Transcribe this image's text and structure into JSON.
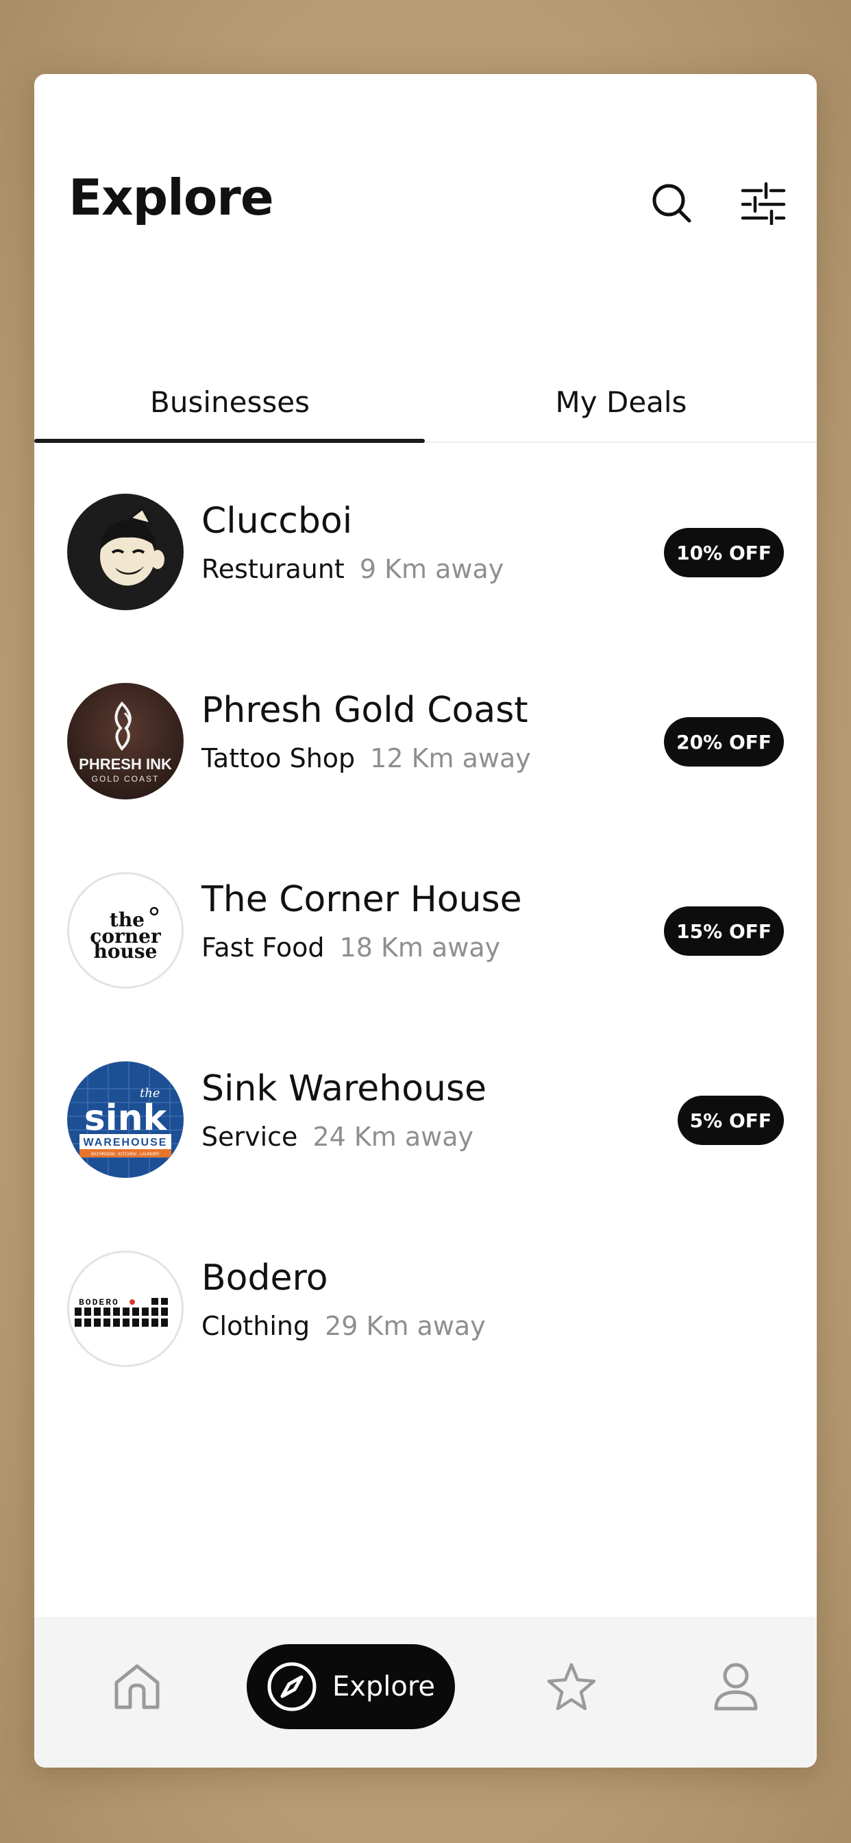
{
  "header": {
    "title": "Explore",
    "search_icon": "search-icon",
    "filter_icon": "sliders-icon"
  },
  "tabs": [
    {
      "label": "Businesses",
      "active": true
    },
    {
      "label": "My Deals",
      "active": false
    }
  ],
  "businesses": [
    {
      "name": "Cluccboi",
      "category": "Resturaunt",
      "distance": "9 Km away",
      "deal": "10% OFF",
      "logo": "cartoon-face-logo"
    },
    {
      "name": "Phresh Gold Coast",
      "category": "Tattoo Shop",
      "distance": "12 Km away",
      "deal": "20% OFF",
      "logo": "phresh-ink-logo",
      "logo_text": "PHRESH INK",
      "logo_subtext": "GOLD COAST"
    },
    {
      "name": "The Corner House",
      "category": "Fast Food",
      "distance": "18 Km away",
      "deal": "15% OFF",
      "logo": "corner-house-logo",
      "logo_text": [
        "the",
        "corner",
        "house"
      ]
    },
    {
      "name": "Sink Warehouse",
      "category": "Service",
      "distance": "24 Km away",
      "deal": "5% OFF",
      "logo": "sink-warehouse-logo",
      "logo_text": [
        "the",
        "sink",
        "WAREHOUSE",
        "BATHROOM · KITCHEN · LAUNDRY"
      ]
    },
    {
      "name": "Bodero",
      "category": "Clothing",
      "distance": "29 Km away",
      "deal": null,
      "logo": "bodero-logo",
      "logo_text": "BODERO"
    }
  ],
  "bottom_nav": {
    "home_icon": "home-icon",
    "explore_label": "Explore",
    "explore_icon": "compass-icon",
    "favorites_icon": "star-icon",
    "profile_icon": "user-icon",
    "active": "explore"
  },
  "colors": {
    "background": "#b89f78",
    "card": "#ffffff",
    "text": "#111111",
    "muted": "#8f8f8f",
    "badge": "#0d0d0d",
    "nav_bg": "#f4f4f4",
    "sink_blue": "#1d4f95",
    "sink_orange": "#e8742c"
  }
}
